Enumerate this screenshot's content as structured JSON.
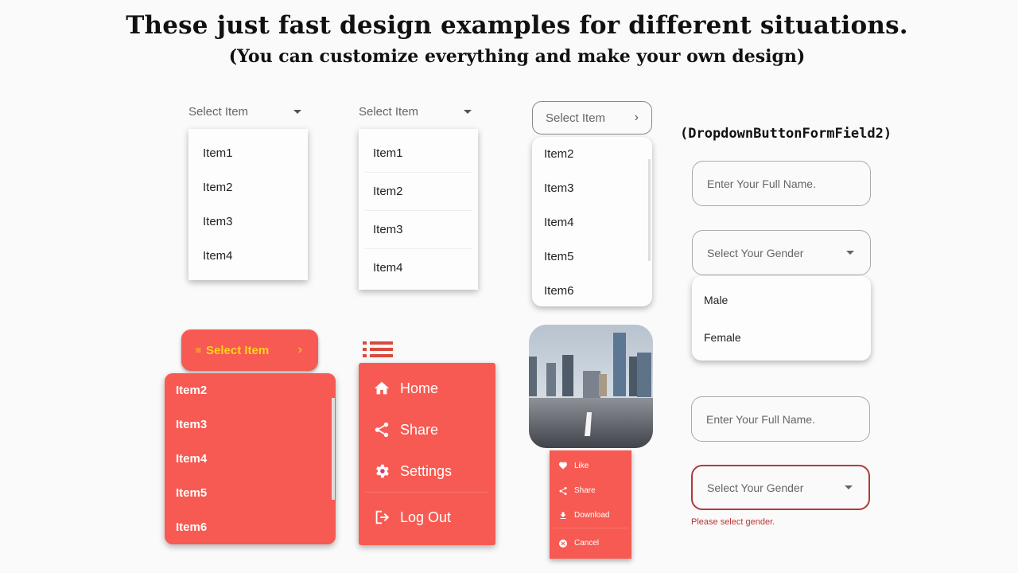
{
  "header": {
    "title": "These just fast design examples for different situations.",
    "subtitle": "(You can customize everything and make your own design)"
  },
  "dropdown1": {
    "hint": "Select Item",
    "icon": "caret-down-icon",
    "items": [
      "Item1",
      "Item2",
      "Item3",
      "Item4"
    ]
  },
  "dropdown2": {
    "hint": "Select Item",
    "icon": "caret-down-icon",
    "items": [
      "Item1",
      "Item2",
      "Item3",
      "Item4"
    ]
  },
  "dropdown3": {
    "hint": "Select Item",
    "icon": "chevron-right-icon",
    "items": [
      "Item2",
      "Item3",
      "Item4",
      "Item5",
      "Item6"
    ]
  },
  "dropdown4": {
    "hint": "Select Item",
    "leading_icon": "list-icon",
    "icon": "chevron-right-icon",
    "items": [
      "Item2",
      "Item3",
      "Item4",
      "Item5",
      "Item6"
    ]
  },
  "nav_menu": {
    "trigger_icon": "list-menu-icon",
    "items": [
      {
        "label": "Home",
        "icon": "home-icon"
      },
      {
        "label": "Share",
        "icon": "share-icon"
      },
      {
        "label": "Settings",
        "icon": "gear-icon"
      },
      {
        "label": "Log Out",
        "icon": "logout-icon"
      }
    ]
  },
  "image_menu": {
    "image": "city-road-photo",
    "items": [
      {
        "label": "Like",
        "icon": "heart-icon"
      },
      {
        "label": "Share",
        "icon": "share-icon"
      },
      {
        "label": "Download",
        "icon": "download-icon"
      },
      {
        "label": "Cancel",
        "icon": "cancel-icon"
      }
    ]
  },
  "form_field": {
    "title": "(DropdownButtonFormField2)",
    "form1": {
      "name_placeholder": "Enter Your Full Name.",
      "gender_hint": "Select Your Gender",
      "options": [
        "Male",
        "Female"
      ]
    },
    "form2": {
      "name_placeholder": "Enter Your Full Name.",
      "gender_hint": "Select Your Gender",
      "error": "Please select gender."
    }
  },
  "colors": {
    "accent_red": "#f75a52",
    "accent_yellow": "#ffd21e",
    "error_red": "#b23a3a",
    "background": "#fafafa"
  }
}
